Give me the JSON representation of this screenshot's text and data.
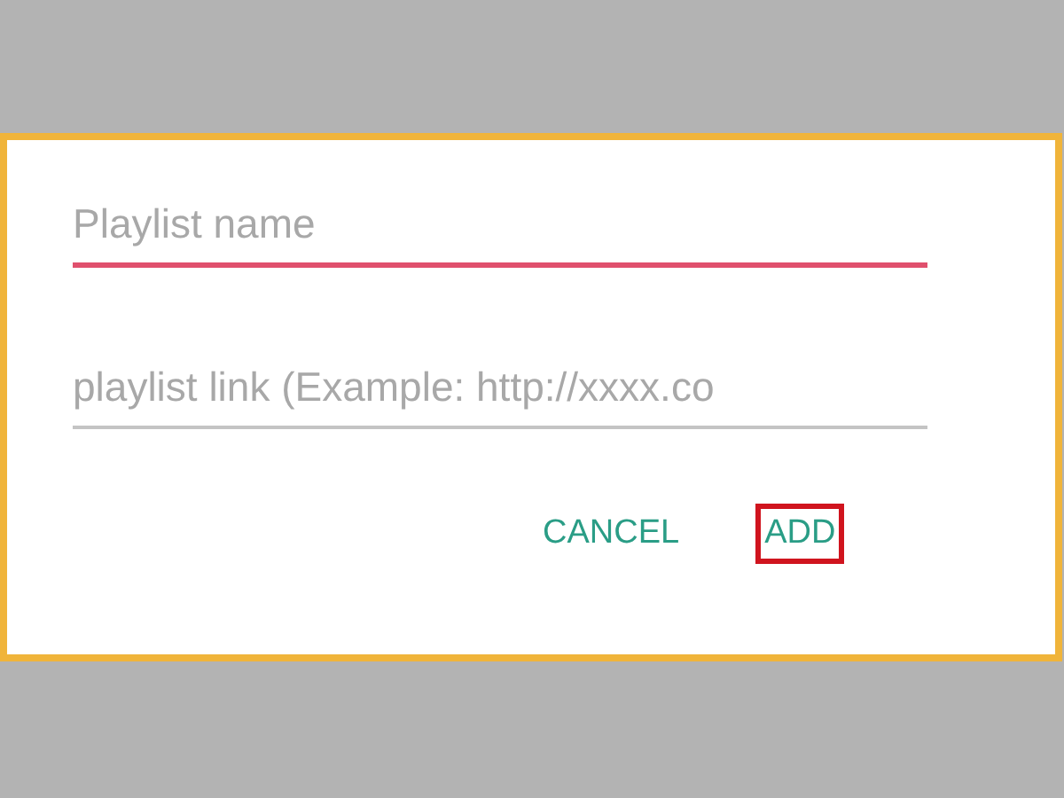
{
  "dialog": {
    "fields": [
      {
        "placeholder": "Playlist name",
        "focused": true
      },
      {
        "placeholder": "playlist link (Example: http://xxxx.co",
        "focused": false
      }
    ],
    "buttons": [
      {
        "label": "CANCEL",
        "highlighted": false
      },
      {
        "label": "ADD",
        "highlighted": true
      }
    ]
  }
}
